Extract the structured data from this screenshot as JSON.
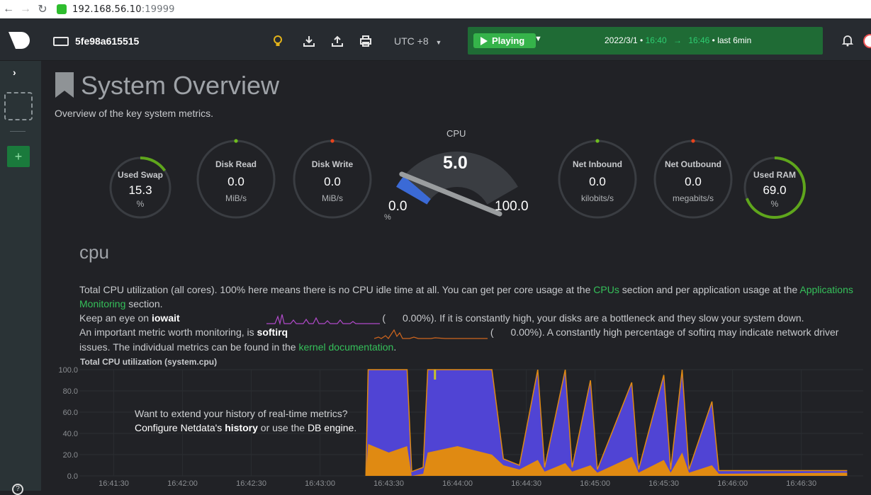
{
  "browser": {
    "url_host": "192.168.56.10",
    "url_port": ":19999"
  },
  "topbar": {
    "node_name": "5fe98a615515",
    "timezone": "UTC +8",
    "play_label": "Playing",
    "date": "2022/3/1",
    "time_start": "16:40",
    "time_end": "16:46",
    "range_suffix": "last 6min"
  },
  "page": {
    "title": "System Overview",
    "subtitle": "Overview of the key system metrics."
  },
  "gauges": [
    {
      "label": "Used Swap",
      "value": "15.3",
      "unit": "%",
      "fraction": 0.153
    },
    {
      "label": "Disk Read",
      "value": "0.0",
      "unit": "MiB/s",
      "fraction": 0
    },
    {
      "label": "Disk Write",
      "value": "0.0",
      "unit": "MiB/s",
      "fraction": 0
    },
    {
      "label": "Net Inbound",
      "value": "0.0",
      "unit": "kilobits/s",
      "fraction": 0
    },
    {
      "label": "Net Outbound",
      "value": "0.0",
      "unit": "megabits/s",
      "fraction": 0
    },
    {
      "label": "Used RAM",
      "value": "69.0",
      "unit": "%",
      "fraction": 0.69
    }
  ],
  "cpu_gauge": {
    "title": "CPU",
    "value": "5.0",
    "min": "0.0",
    "max": "100.0",
    "unit": "%"
  },
  "cpu_section": {
    "title": "cpu",
    "p1_a": "Total CPU utilization (all cores). 100% here means there is no CPU idle time at all. You can get per core usage at the ",
    "link_cpus": "CPUs",
    "p1_b": " section and per application usage at the ",
    "link_apps": "Applications Monitoring",
    "p1_c": " section.",
    "p2_a": "Keep an eye on ",
    "p2_b": "iowait",
    "p2_val": "0.00%",
    "p2_c": "). If it is constantly high, your disks are a bottleneck and they slow your system down.",
    "p3_a": "An important metric worth monitoring, is ",
    "p3_b": "softirq",
    "p3_val": "0.00%",
    "p3_c": "). A constantly high percentage of softirq may indicate network driver issues. The individual metrics can be found in the ",
    "link_kernel": "kernel documentation",
    "p3_d": "."
  },
  "chart_data": {
    "type": "area",
    "title": "Total CPU utilization (system.cpu)",
    "ylim": [
      0,
      100
    ],
    "y_ticks": [
      "100.0",
      "80.0",
      "60.0",
      "40.0",
      "20.0",
      "0.0"
    ],
    "x_ticks": [
      "16:41:30",
      "16:42:00",
      "16:42:30",
      "16:43:00",
      "16:43:30",
      "16:44:00",
      "16:44:30",
      "16:45:00",
      "16:45:30",
      "16:46:00",
      "16:46:30"
    ],
    "colors": {
      "user": "#5044d4",
      "system": "#e08a12",
      "iowait": "#c6c428",
      "softirq": "#a53a3a"
    },
    "stacked_samples": [
      {
        "t": "16:43:20",
        "system": 0,
        "user": 0
      },
      {
        "t": "16:43:21",
        "system": 30,
        "user": 70
      },
      {
        "t": "16:43:30",
        "system": 22,
        "user": 78
      },
      {
        "t": "16:43:38",
        "system": 28,
        "user": 72
      },
      {
        "t": "16:43:40",
        "system": 0,
        "user": 4
      },
      {
        "t": "16:43:45",
        "system": 2,
        "user": 6
      },
      {
        "t": "16:43:47",
        "system": 22,
        "user": 78
      },
      {
        "t": "16:44:00",
        "system": 28,
        "user": 72
      },
      {
        "t": "16:44:15",
        "system": 20,
        "user": 80
      },
      {
        "t": "16:44:20",
        "system": 10,
        "user": 6
      },
      {
        "t": "16:44:27",
        "system": 6,
        "user": 4
      },
      {
        "t": "16:44:35",
        "system": 15,
        "user": 85
      },
      {
        "t": "16:44:38",
        "system": 4,
        "user": 4
      },
      {
        "t": "16:44:47",
        "system": 12,
        "user": 88
      },
      {
        "t": "16:44:50",
        "system": 4,
        "user": 4
      },
      {
        "t": "16:44:58",
        "system": 10,
        "user": 80
      },
      {
        "t": "16:45:01",
        "system": 3,
        "user": 3
      },
      {
        "t": "16:45:16",
        "system": 18,
        "user": 70
      },
      {
        "t": "16:45:19",
        "system": 3,
        "user": 3
      },
      {
        "t": "16:45:30",
        "system": 15,
        "user": 80
      },
      {
        "t": "16:45:33",
        "system": 3,
        "user": 3
      },
      {
        "t": "16:45:38",
        "system": 22,
        "user": 78
      },
      {
        "t": "16:45:41",
        "system": 3,
        "user": 3
      },
      {
        "t": "16:45:51",
        "system": 10,
        "user": 60
      },
      {
        "t": "16:45:54",
        "system": 2,
        "user": 3
      },
      {
        "t": "16:46:50",
        "system": 3,
        "user": 2
      }
    ]
  },
  "history_msg": {
    "line1": "Want to extend your history of real-time metrics?",
    "a": "Configure Netdata's ",
    "b": "history",
    "c": " or use the ",
    "d": "DB engine",
    "e": "."
  }
}
